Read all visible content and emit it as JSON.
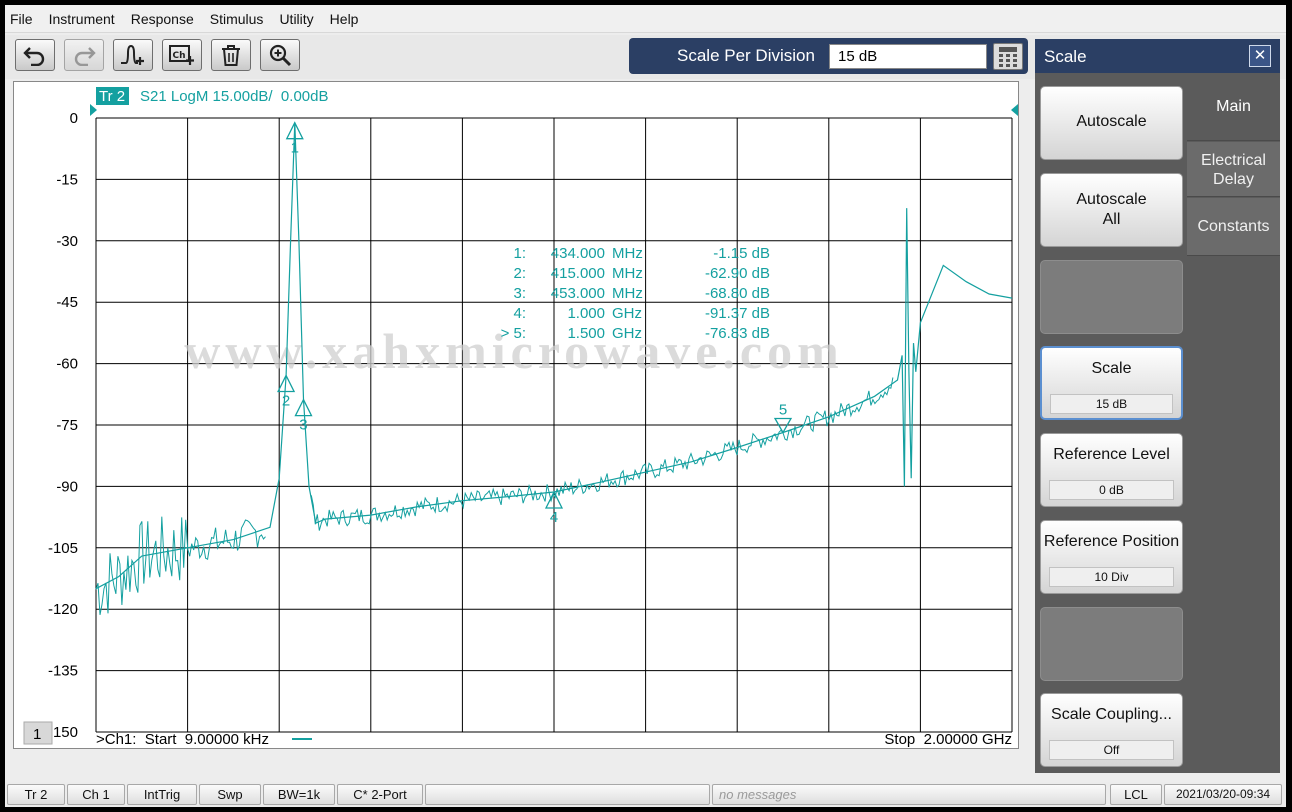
{
  "menu": [
    "File",
    "Instrument",
    "Response",
    "Stimulus",
    "Utility",
    "Help"
  ],
  "toolbar": {
    "icons": [
      "undo-icon",
      "redo-icon",
      "add-marker-icon",
      "add-channel-icon",
      "delete-icon",
      "zoom-icon"
    ],
    "spd_label": "Scale Per Division",
    "spd_value": "15 dB"
  },
  "panel": {
    "title": "Scale",
    "close": "✕",
    "softkeys": [
      {
        "label": "Autoscale"
      },
      {
        "label_line1": "Autoscale",
        "label_line2": "All"
      },
      {
        "label": "Scale",
        "value": "15 dB"
      },
      {
        "label": "Reference Level",
        "value": "0 dB"
      },
      {
        "label": "Reference Position",
        "value": "10 Div"
      },
      {
        "label": "Scale Coupling...",
        "value": "Off"
      }
    ],
    "tabs": [
      {
        "label": "Main"
      },
      {
        "label_line1": "Electrical",
        "label_line2": "Delay"
      },
      {
        "label": "Constants"
      }
    ]
  },
  "trace": {
    "id": "Tr 2",
    "desc": "S21 LogM 15.00dB/  0.00dB",
    "color": "#14a0a0"
  },
  "markers": [
    {
      "id": "1",
      "prefix": "1:",
      "freq": "434.000",
      "unit": "MHz",
      "value": "-1.15 dB"
    },
    {
      "id": "2",
      "prefix": "2:",
      "freq": "415.000",
      "unit": "MHz",
      "value": "-62.90 dB"
    },
    {
      "id": "3",
      "prefix": "3:",
      "freq": "453.000",
      "unit": "MHz",
      "value": "-68.80 dB"
    },
    {
      "id": "4",
      "prefix": "4:",
      "freq": "1.000",
      "unit": "GHz",
      "value": "-91.37 dB"
    },
    {
      "id": "5",
      "prefix": "> 5:",
      "freq": "1.500",
      "unit": "GHz",
      "value": "-76.83 dB"
    }
  ],
  "watermark": "www.xahxmicrowave.com",
  "channel_number": "1",
  "start_label": ">Ch1:  Start  9.00000 kHz",
  "stop_label": "Stop  2.00000 GHz",
  "chart_data": {
    "type": "line",
    "ylim": [
      -150,
      0
    ],
    "yticks": [
      "0",
      "-15",
      "-30",
      "-45",
      "-60",
      "-75",
      "-90",
      "-105",
      "-120",
      "-135",
      "-150"
    ],
    "xlim": [
      9e-06,
      2.0
    ],
    "x_unit": "GHz",
    "series": [
      {
        "name": "S21 LogM",
        "x": [
          9e-06,
          0.05,
          0.1,
          0.2,
          0.3,
          0.38,
          0.4,
          0.415,
          0.425,
          0.434,
          0.443,
          0.453,
          0.465,
          0.48,
          0.5,
          0.6,
          0.7,
          0.8,
          0.9,
          1.0,
          1.1,
          1.2,
          1.3,
          1.4,
          1.5,
          1.6,
          1.7,
          1.75,
          1.76,
          1.765,
          1.77,
          1.775,
          1.78,
          1.785,
          1.79,
          1.8,
          1.85,
          1.9,
          1.95,
          2.0
        ],
        "y": [
          -115,
          -112,
          -107,
          -105,
          -103,
          -100,
          -88,
          -62.9,
          -30,
          -1.15,
          -30,
          -68.8,
          -90,
          -99,
          -98,
          -97,
          -95,
          -93.5,
          -92.5,
          -91.37,
          -89,
          -86.5,
          -84,
          -80.5,
          -76.83,
          -73,
          -68,
          -64,
          -58,
          -90,
          -22,
          -62,
          -88,
          -55,
          -62,
          -50,
          -36,
          -40,
          -43,
          -44
        ]
      }
    ]
  },
  "statusbar": [
    "Tr 2",
    "Ch 1",
    "IntTrig",
    "Swp",
    "BW=1k",
    "C* 2-Port",
    "",
    "no messages",
    "LCL",
    "2021/03/20-09:34"
  ]
}
